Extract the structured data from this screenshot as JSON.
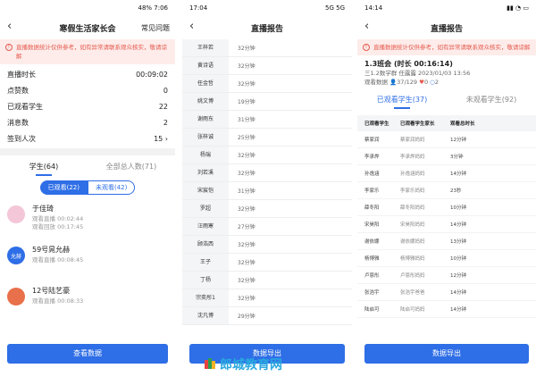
{
  "p1": {
    "status_left": "",
    "status_right": "48% 7:06",
    "title": "寒假生活家长会",
    "right_link": "常见问题",
    "notice": "直播数据统计仅供参考，如有异常请联系观众核实，敬请谅解",
    "stats": [
      {
        "label": "直播时长",
        "value": "00:09:02"
      },
      {
        "label": "点赞数",
        "value": "0"
      },
      {
        "label": "已观看学生",
        "value": "22"
      },
      {
        "label": "消息数",
        "value": "2"
      },
      {
        "label": "签到人次",
        "value": "15 ›"
      }
    ],
    "tabs": [
      "学生(64)",
      "全部总人数(71)"
    ],
    "seg": [
      "已观看(22)",
      "未观看(42)"
    ],
    "students": [
      {
        "name": "于佳琦",
        "l1": "观看直播 00:02:44",
        "l2": "观看回放 00:17:45",
        "color": "#f3c6d8",
        "tag": ""
      },
      {
        "name": "59号晁允赫",
        "l1": "观看直播 00:08:45",
        "l2": "",
        "color": "#2e6ee6",
        "tag": "允赫"
      },
      {
        "name": "12号陆艺豪",
        "l1": "观看直播 00:08:33",
        "l2": "",
        "color": "#e8704a",
        "tag": ""
      }
    ],
    "button": "查看数据"
  },
  "p2": {
    "time": "17:04",
    "status_right": "5G 5G",
    "title": "直播报告",
    "rows": [
      {
        "name": "王梓若",
        "dur": "32分钟"
      },
      {
        "name": "黄诗语",
        "dur": "32分钟"
      },
      {
        "name": "任金哲",
        "dur": "32分钟"
      },
      {
        "name": "姚文博",
        "dur": "19分钟"
      },
      {
        "name": "谢雨东",
        "dur": "31分钟"
      },
      {
        "name": "张梓诚",
        "dur": "25分钟"
      },
      {
        "name": "杨瑞",
        "dur": "32分钟"
      },
      {
        "name": "刘若溪",
        "dur": "32分钟"
      },
      {
        "name": "宋宸恺",
        "dur": "31分钟"
      },
      {
        "name": "罗超",
        "dur": "32分钟"
      },
      {
        "name": "汪雨寒",
        "dur": "27分钟"
      },
      {
        "name": "顾浩西",
        "dur": "32分钟"
      },
      {
        "name": "王子",
        "dur": "32分钟"
      },
      {
        "name": "丁杨",
        "dur": "32分钟"
      },
      {
        "name": "宗奕彤1",
        "dur": "32分钟"
      },
      {
        "name": "沈凡博",
        "dur": "29分钟"
      }
    ],
    "button": "数据导出"
  },
  "p3": {
    "time": "14:14",
    "title": "直播报告",
    "notice": "直播数据统计仅供参考，如有异常请联系观众核实，敬请谅解",
    "class_title": "1.3班会 (时长 00:16:14)",
    "class_sub": "三1.2数学群 任露露 2023/01/03 13:56",
    "watch_label": "观看数据",
    "watch_count": "37/129",
    "likes": "0",
    "comments": "2",
    "tabs": [
      "已观看学生(37)",
      "未观看学生(92)"
    ],
    "headers": [
      "已观看学生",
      "已观看学生家长",
      "观看总时长"
    ],
    "rows": [
      [
        "蔡家润",
        "蔡家润妈妈",
        "12分钟"
      ],
      [
        "李承烨",
        "李承烨妈妈",
        "3分钟"
      ],
      [
        "孙逸涵",
        "孙逸涵妈妈",
        "14分钟"
      ],
      [
        "李家乐",
        "李家乐妈妈",
        "23秒"
      ],
      [
        "薛冬阳",
        "薛冬阳妈妈",
        "10分钟"
      ],
      [
        "宋昊阳",
        "宋昊阳妈妈",
        "14分钟"
      ],
      [
        "谢依娜",
        "谢依娜妈妈",
        "13分钟"
      ],
      [
        "杨博雅",
        "杨博雅妈妈",
        "10分钟"
      ],
      [
        "卢恩彤",
        "卢恩彤妈妈",
        "12分钟"
      ],
      [
        "张浩宇",
        "张浩宇爸爸",
        "14分钟"
      ],
      [
        "陆启可",
        "陆启可妈妈",
        "14分钟"
      ]
    ],
    "button": "数据导出"
  },
  "watermark": "郎城教育网"
}
